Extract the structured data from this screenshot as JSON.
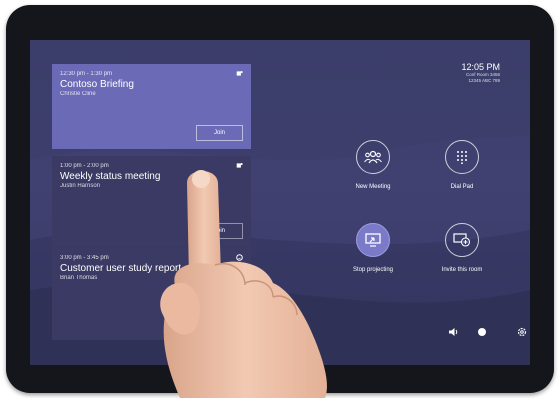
{
  "meetings": [
    {
      "time": "12:30 pm - 1:30 pm",
      "title": "Contoso Briefing",
      "organizer": "Christie Cline",
      "action": "Join"
    },
    {
      "time": "1:00 pm - 2:00 pm",
      "title": "Weekly status meeting",
      "organizer": "Justin Harrison",
      "action": "Join"
    },
    {
      "time": "3:00 pm - 3:45 pm",
      "title": "Customer user study report out",
      "organizer": "Brian Thomas"
    }
  ],
  "clock": {
    "time": "12:05 PM",
    "line1": "Conf Room 3456",
    "line2": "12345 ABC 789"
  },
  "actions": {
    "new_meeting": "New Meeting",
    "dial_pad": "Dial Pad",
    "stop_projecting": "Stop projecting",
    "invite_this_room": "Invite this room"
  },
  "icons": [
    "people-icon",
    "dialpad-icon",
    "project-screen-icon",
    "invite-room-icon",
    "volume-icon",
    "settings-icon"
  ],
  "colors": {
    "active_card": "#6b6ab6",
    "card": "#3a3a64",
    "screen_bg": "#3d3e6b"
  }
}
